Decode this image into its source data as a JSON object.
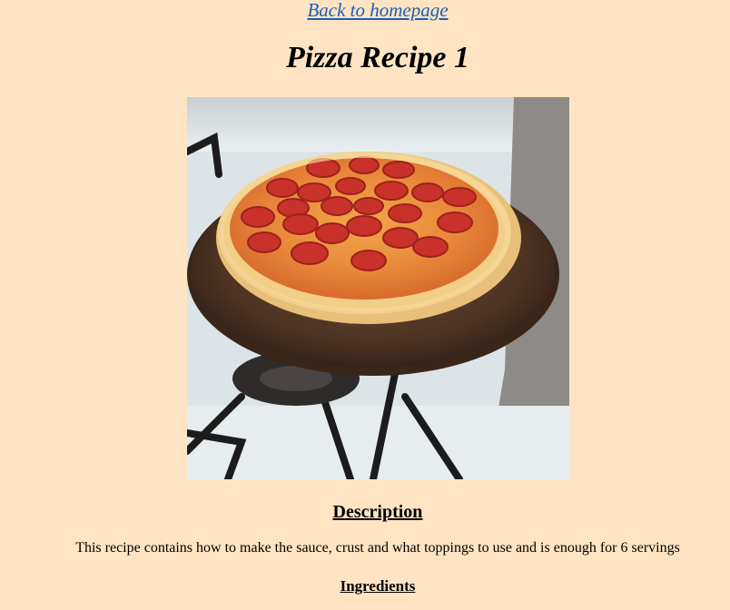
{
  "nav": {
    "back_link": "Back to homepage"
  },
  "recipe": {
    "title": "Pizza Recipe 1",
    "photo_subject": "pepperoni pizza on a pan on a stovetop",
    "description_heading": "Description",
    "description_text": "This recipe contains how to make the sauce, crust and what toppings to use and is enough for 6 servings",
    "ingredients_heading": "Ingredients"
  },
  "colors": {
    "page_background": "#ffe4c4",
    "link": "#1a5fb4",
    "text": "#000000"
  }
}
